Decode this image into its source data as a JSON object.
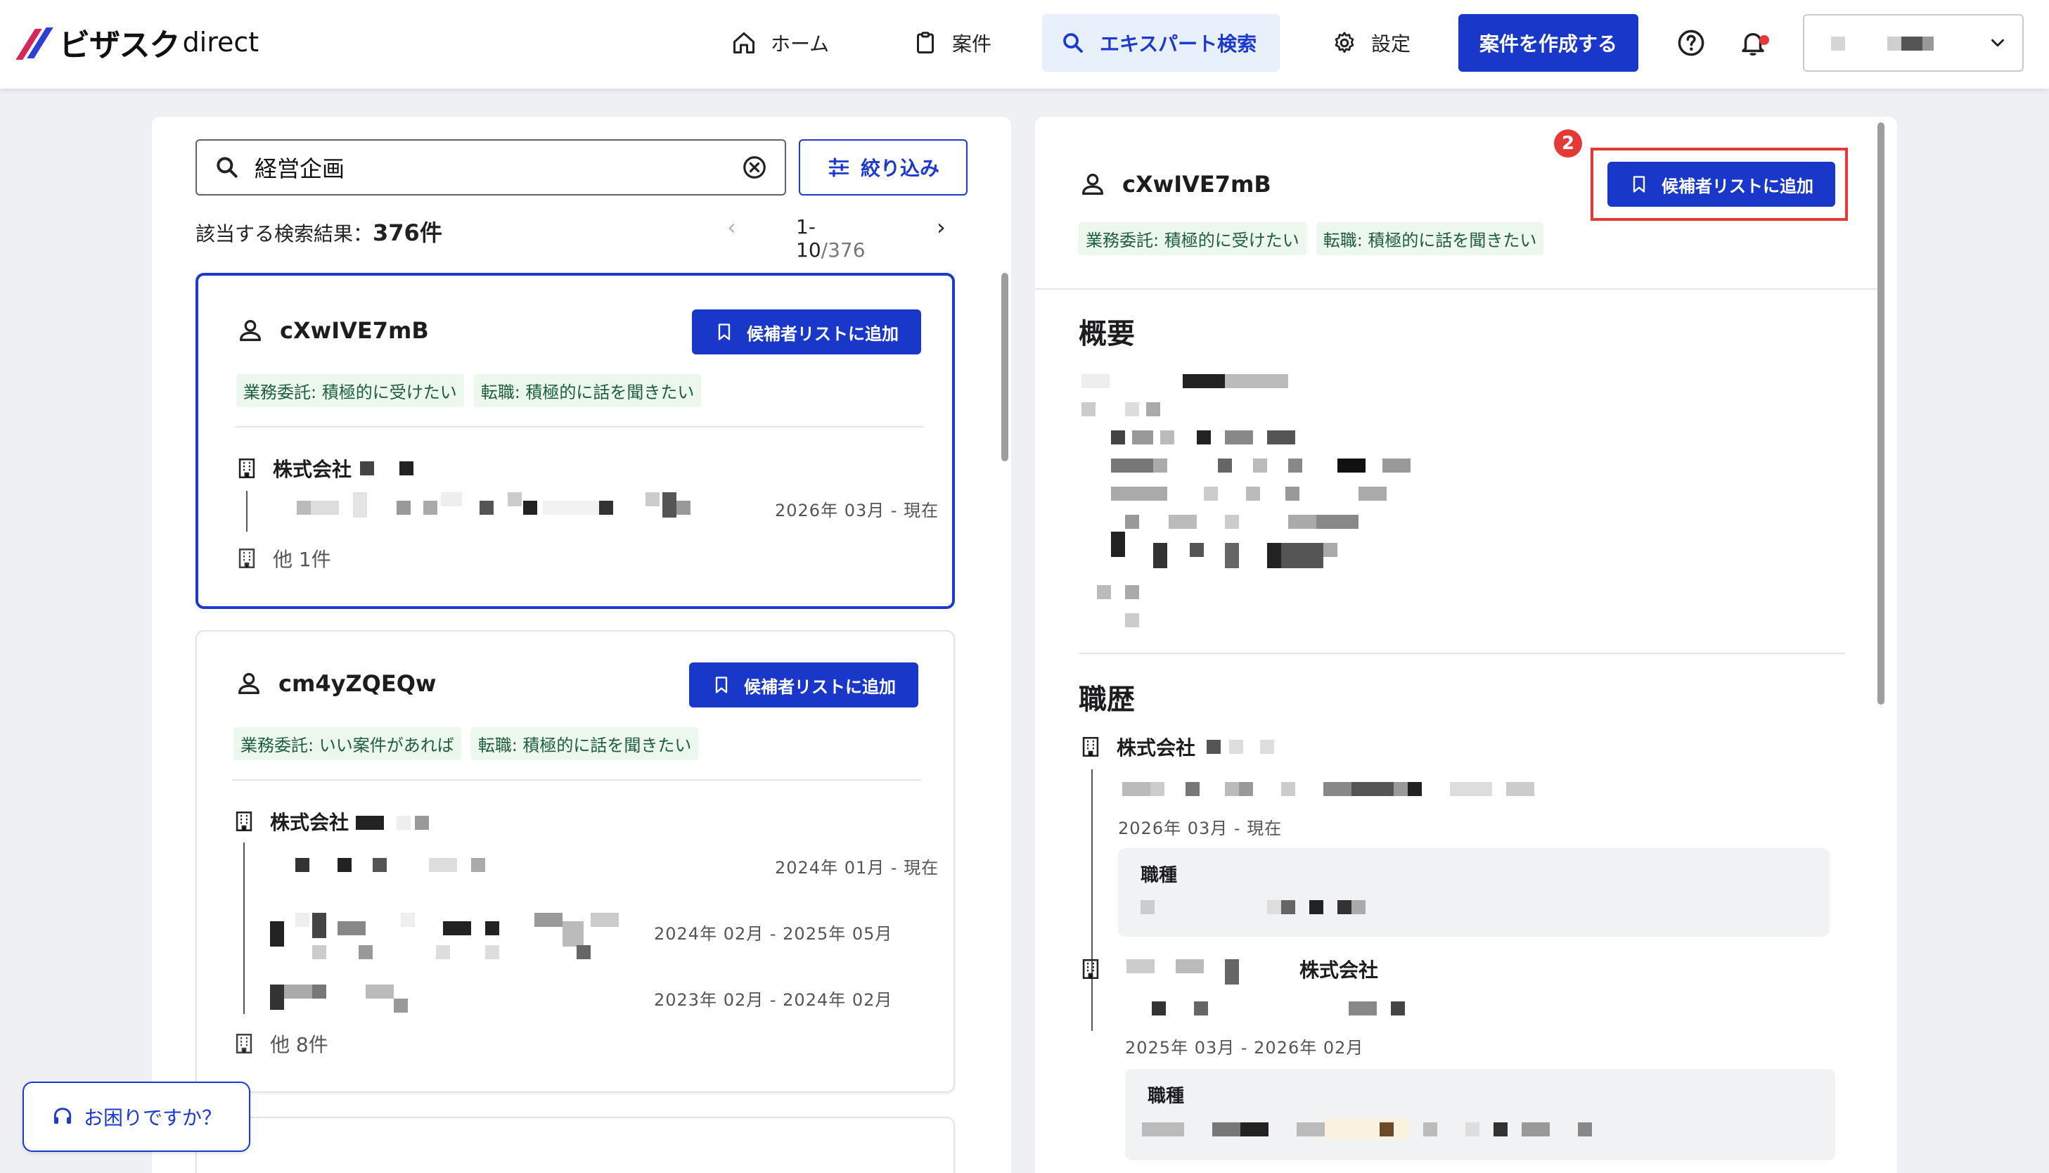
{
  "brand": {
    "jp": "ビザスク",
    "en": "direct"
  },
  "nav": {
    "home": "ホーム",
    "projects": "案件",
    "expert_search": "エキスパート検索",
    "settings": "設定",
    "create_project": "案件を作成する"
  },
  "search": {
    "query": "経営企画",
    "filter_label": "絞り込み",
    "result_prefix": "該当する検索結果：",
    "result_count": "376件",
    "page_range": "1-10",
    "page_total": "/376",
    "prev": "‹",
    "next": "›"
  },
  "cards": [
    {
      "name": "cXwIVE7mB",
      "add_label": "候補者リストに追加",
      "tags": [
        "業務委託: 積極的に受けたい",
        "転職: 積極的に話を聞きたい"
      ],
      "company": "株式会社",
      "periods": [
        "2026年 03月 - 現在"
      ],
      "others": "他 1件"
    },
    {
      "name": "cm4yZQEQw",
      "add_label": "候補者リストに追加",
      "tags": [
        "業務委託: いい案件があれば",
        "転職: 積極的に話を聞きたい"
      ],
      "company": "株式会社",
      "periods": [
        "2024年 01月 - 現在",
        "2024年 02月 - 2025年 05月",
        "2023年 02月 - 2024年 02月"
      ],
      "others": "他 8件"
    }
  ],
  "detail": {
    "name": "cXwIVE7mB",
    "add_label": "候補者リストに追加",
    "step_badge": "2",
    "tags": [
      "業務委託: 積極的に受けたい",
      "転職: 積極的に話を聞きたい"
    ],
    "overview_title": "概要",
    "career_title": "職歴",
    "career": [
      {
        "company": "株式会社",
        "period": "2026年 03月 - 現在",
        "role_label": "職種"
      },
      {
        "company": "株式会社",
        "period": "2025年 03月 - 2026年 02月",
        "role_label": "職種"
      }
    ]
  },
  "help": {
    "label": "お困りですか？"
  },
  "colors": {
    "accent": "#1937c8",
    "highlight": "#e53935",
    "tag_bg": "#ecf7ee"
  }
}
